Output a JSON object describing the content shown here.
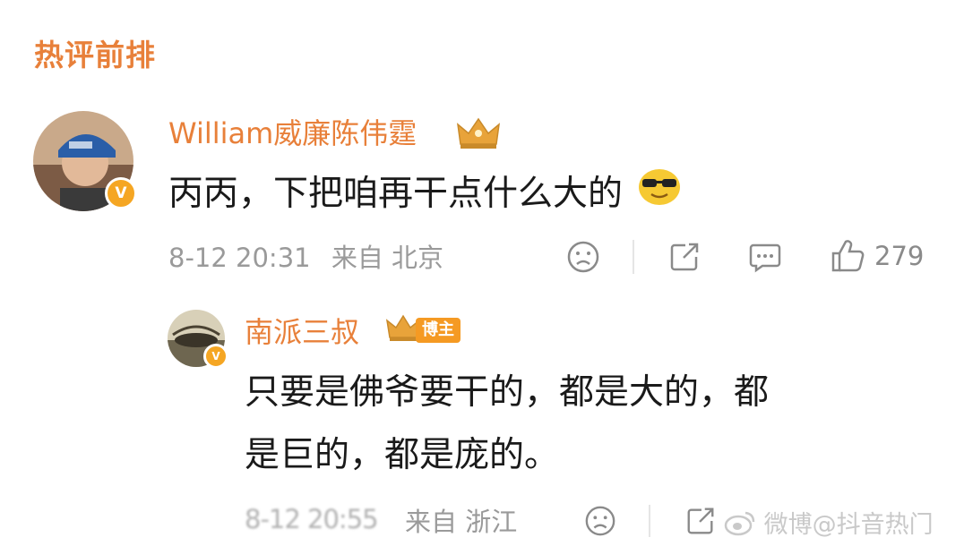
{
  "section": {
    "title": "热评前排"
  },
  "comments": [
    {
      "username": "William威廉陈伟霆",
      "text": "丙丙，下把咱再干点什么大的",
      "emoji": "sunglasses-emoji",
      "time": "8-12 20:31",
      "source": "来自 北京",
      "likes": "279"
    }
  ],
  "reply": {
    "username": "南派三叔",
    "owner_tag": "博主",
    "text_line1": "只要是佛爷要干的，都是大的，都",
    "text_line2": "是巨的，都是庞的。",
    "time": "8-12 20:55",
    "source": "来自 浙江"
  },
  "watermark": "微博@抖音热门"
}
